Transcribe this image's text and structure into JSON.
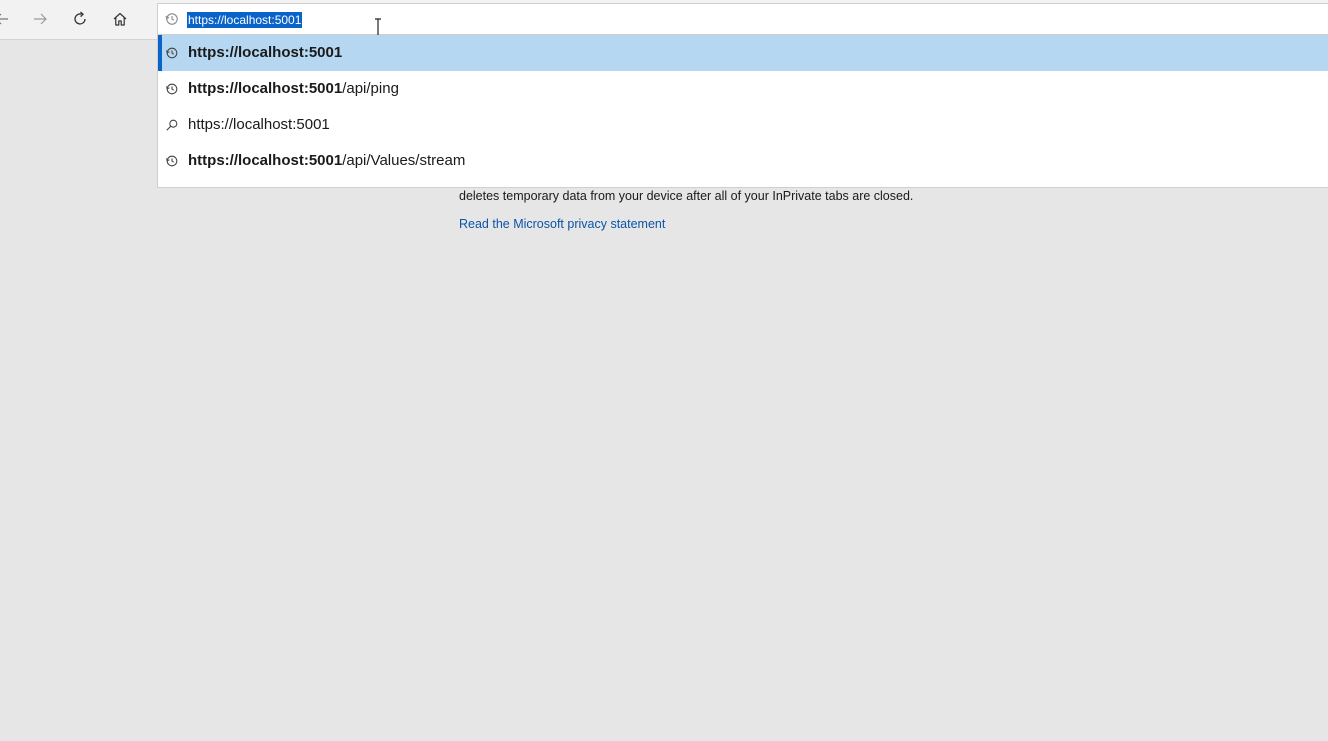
{
  "toolbar": {
    "back_icon": "arrow-left-icon",
    "forward_icon": "arrow-right-icon",
    "refresh_icon": "refresh-icon",
    "home_icon": "home-icon"
  },
  "address_bar": {
    "value": "https://localhost:5001",
    "icon": "history-icon",
    "selection_color": "#0a63c9"
  },
  "suggestions": [
    {
      "icon": "history-icon",
      "bold": "https://localhost:5001",
      "rest": ""
    },
    {
      "icon": "history-icon",
      "bold": "https://localhost:5001",
      "rest": "/api/ping"
    },
    {
      "icon": "search-icon",
      "bold": "",
      "rest": "https://localhost:5001"
    },
    {
      "icon": "history-icon",
      "bold": "https://localhost:5001",
      "rest": "/api/Values/stream"
    }
  ],
  "page": {
    "text_line": "deletes temporary data from your device after all of your InPrivate tabs are closed.",
    "privacy_link": "Read the Microsoft privacy statement"
  },
  "colors": {
    "selected_row": "#b5d7f2",
    "accent": "#0a63c9",
    "link": "#0b54a8",
    "page_background": "#e6e6e6"
  }
}
